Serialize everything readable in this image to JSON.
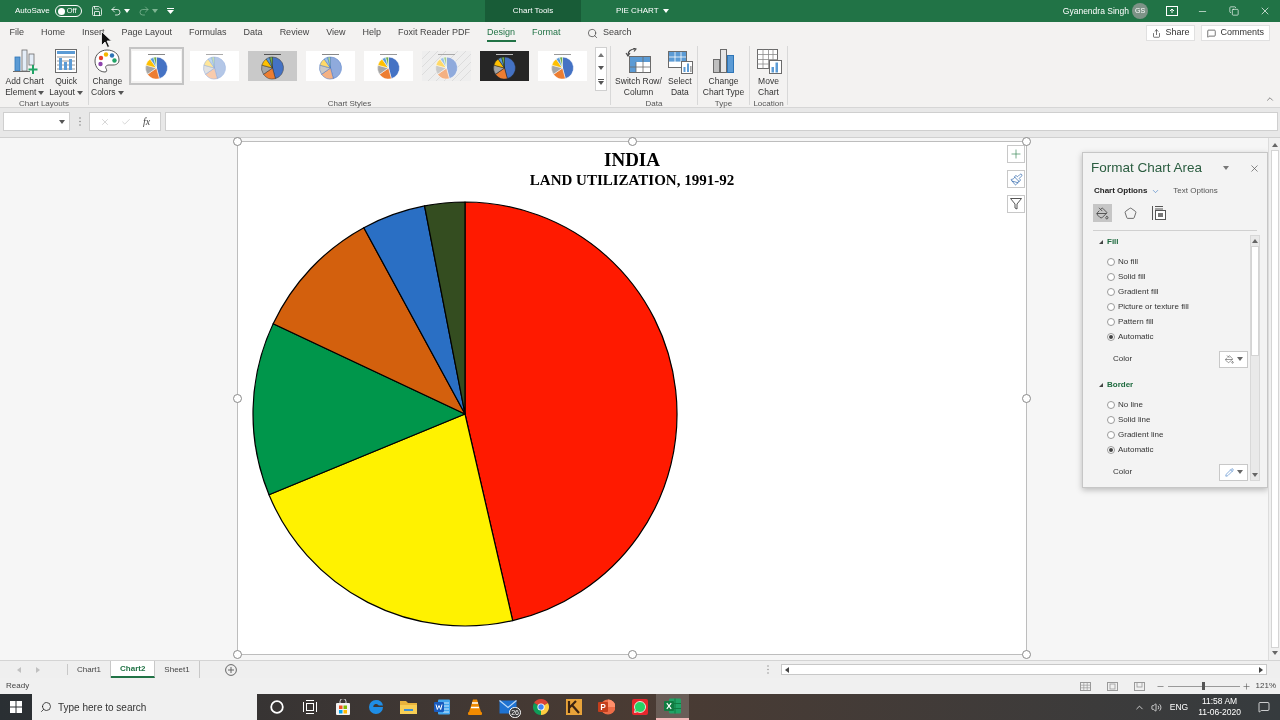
{
  "title_bar": {
    "autosave": {
      "label": "AutoSave",
      "text": "Off",
      "on": false
    },
    "context_label": "Chart Tools",
    "document": "PIE CHART",
    "user": {
      "name": "Gyanendra Singh",
      "initials": "GS"
    }
  },
  "ribbon_tabs": [
    {
      "label": "File",
      "selected": false,
      "contextual": false
    },
    {
      "label": "Home",
      "selected": false,
      "contextual": false
    },
    {
      "label": "Insert",
      "selected": false,
      "contextual": false
    },
    {
      "label": "Page Layout",
      "selected": false,
      "contextual": false
    },
    {
      "label": "Formulas",
      "selected": false,
      "contextual": false
    },
    {
      "label": "Data",
      "selected": false,
      "contextual": false
    },
    {
      "label": "Review",
      "selected": false,
      "contextual": false
    },
    {
      "label": "View",
      "selected": false,
      "contextual": false
    },
    {
      "label": "Help",
      "selected": false,
      "contextual": false
    },
    {
      "label": "Foxit Reader PDF",
      "selected": false,
      "contextual": false
    },
    {
      "label": "Design",
      "selected": true,
      "contextual": true
    },
    {
      "label": "Format",
      "selected": false,
      "contextual": true
    }
  ],
  "tell_me": {
    "placeholder": "Search"
  },
  "share_button": "Share",
  "comments_button": "Comments",
  "ribbon": {
    "groups": [
      {
        "label": "Chart Layouts",
        "buttons": [
          {
            "lines": [
              "Add Chart",
              "Element"
            ],
            "dropdown": true
          },
          {
            "lines": [
              "Quick",
              "Layout"
            ],
            "dropdown": true
          }
        ]
      },
      {
        "label": "Chart Styles",
        "buttons": [
          {
            "lines": [
              "Change",
              "Colors"
            ],
            "dropdown": true
          }
        ],
        "styles": [
          {
            "kind": "outlined",
            "selected": true
          },
          {
            "kind": "striped",
            "selected": false
          },
          {
            "kind": "shaded",
            "selected": false
          },
          {
            "kind": "pastel",
            "selected": false
          },
          {
            "kind": "plain",
            "selected": false
          },
          {
            "kind": "patterned",
            "selected": false
          },
          {
            "kind": "dark",
            "selected": false
          },
          {
            "kind": "plain",
            "selected": false
          }
        ]
      },
      {
        "label": "Data",
        "buttons": [
          {
            "lines": [
              "Switch Row/",
              "Column"
            ],
            "dropdown": false
          },
          {
            "lines": [
              "Select",
              "Data"
            ],
            "dropdown": false
          }
        ]
      },
      {
        "label": "Type",
        "buttons": [
          {
            "lines": [
              "Change",
              "Chart Type"
            ],
            "dropdown": false
          }
        ]
      },
      {
        "label": "Location",
        "buttons": [
          {
            "lines": [
              "Move",
              "Chart"
            ],
            "dropdown": false
          }
        ]
      }
    ]
  },
  "formula_bar": {
    "function_label": "fx"
  },
  "chart": {
    "title": "INDIA",
    "subtitle": "LAND UTILIZATION, 1991-92"
  },
  "format_pane": {
    "title": "Format Chart Area",
    "option_tabs": [
      {
        "label": "Chart Options",
        "selected": true,
        "dropdown": true
      },
      {
        "label": "Text Options",
        "selected": false,
        "dropdown": false
      }
    ],
    "icon_tabs": [
      {
        "selected": true
      },
      {
        "selected": false
      },
      {
        "selected": false
      }
    ],
    "sections": [
      {
        "title": "Fill",
        "expanded": true,
        "options": [
          {
            "label": "No fill",
            "selected": false
          },
          {
            "label": "Solid fill",
            "selected": false
          },
          {
            "label": "Gradient fill",
            "selected": false
          },
          {
            "label": "Picture or texture fill",
            "selected": false
          },
          {
            "label": "Pattern fill",
            "selected": false
          },
          {
            "label": "Automatic",
            "selected": true
          }
        ],
        "color_label": "Color"
      },
      {
        "title": "Border",
        "expanded": true,
        "options": [
          {
            "label": "No line",
            "selected": false
          },
          {
            "label": "Solid line",
            "selected": false
          },
          {
            "label": "Gradient line",
            "selected": false
          },
          {
            "label": "Automatic",
            "selected": true
          }
        ],
        "color_label": "Color"
      }
    ]
  },
  "sheet_tabs": [
    {
      "label": "Chart1",
      "selected": false
    },
    {
      "label": "Chart2",
      "selected": true
    },
    {
      "label": "Sheet1",
      "selected": false
    }
  ],
  "status_bar": {
    "status": "Ready",
    "zoom": "121%",
    "zoom_slider": {
      "level": 0.5
    }
  },
  "taskbar": {
    "search": {
      "placeholder": "Type here to search"
    },
    "apps": [
      {
        "active": false
      },
      {
        "active": false
      },
      {
        "active": false
      },
      {
        "active": false
      },
      {
        "active": false
      },
      {
        "active": false
      },
      {
        "active": false
      },
      {
        "active": false,
        "badge": "26"
      },
      {
        "active": false
      },
      {
        "active": false
      },
      {
        "active": false
      },
      {
        "active": false
      },
      {
        "active": true
      }
    ],
    "language": "ENG",
    "time": "11:58 AM",
    "date": "11-06-2020"
  }
}
